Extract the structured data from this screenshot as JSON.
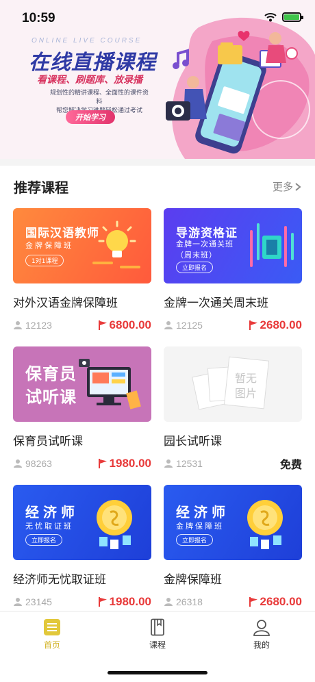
{
  "status": {
    "time": "10:59"
  },
  "banner": {
    "subtitle": "ONLINE LIVE COURSE",
    "title": "在线直播课程",
    "slogan": "看课程、刷题库、放录播",
    "desc_line1": "规划性的精讲课程、全面性的课件资料",
    "desc_line2": "帮您解决学习难题轻松通过考试",
    "button": "开始学习"
  },
  "section": {
    "title": "推荐课程",
    "more": "更多"
  },
  "courses": [
    {
      "thumb_title": "国际汉语教师",
      "thumb_sub": "金牌保障班",
      "thumb_tag": "1对1课程",
      "name": "对外汉语金牌保障班",
      "students": "12123",
      "price": "6800.00"
    },
    {
      "thumb_title": "导游资格证",
      "thumb_sub": "金牌一次通关班",
      "thumb_sub2": "（周末班）",
      "thumb_tag": "立即报名",
      "name": "金牌一次通关周末班",
      "students": "12125",
      "price": "2680.00"
    },
    {
      "thumb_title": "保育员",
      "thumb_sub": "试听课",
      "name": "保育员试听课",
      "students": "98263",
      "price": "1980.00"
    },
    {
      "thumb_placeholder_line1": "暂无",
      "thumb_placeholder_line2": "图片",
      "name": "园长试听课",
      "students": "12531",
      "price": "免费"
    },
    {
      "thumb_title": "经济师",
      "thumb_sub": "无忧取证班",
      "thumb_tag": "立即报名",
      "name": "经济师无忧取证班",
      "students": "23145",
      "price": "1980.00"
    },
    {
      "thumb_title": "经济师",
      "thumb_sub": "金牌保障班",
      "thumb_tag": "立即报名",
      "name": "金牌保障班",
      "students": "26318",
      "price": "2680.00"
    }
  ],
  "tabs": [
    {
      "label": "首页",
      "icon": "home-icon",
      "active": true
    },
    {
      "label": "课程",
      "icon": "book-icon",
      "active": false
    },
    {
      "label": "我的",
      "icon": "user-icon",
      "active": false
    }
  ],
  "colors": {
    "accent": "#d3b52a",
    "price": "#e83a3a",
    "banner_title": "#2f3aa5",
    "banner_slogan": "#d8335f"
  }
}
